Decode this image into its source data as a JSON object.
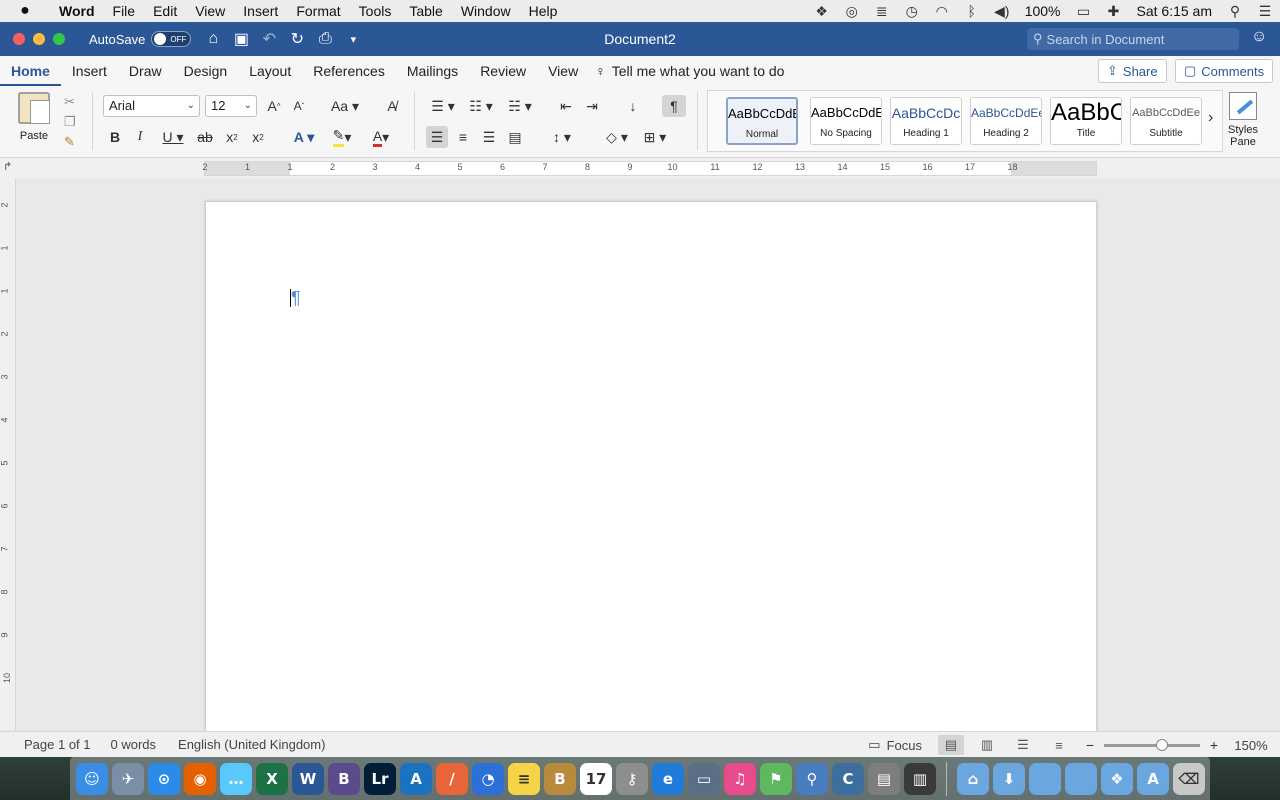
{
  "menubar": {
    "app_name": "Word",
    "items": [
      "File",
      "Edit",
      "View",
      "Insert",
      "Format",
      "Tools",
      "Table",
      "Window",
      "Help"
    ],
    "battery": "100%",
    "clock": "Sat 6:15 am"
  },
  "titlebar": {
    "autosave_label": "AutoSave",
    "autosave_state": "OFF",
    "document_title": "Document2",
    "search_placeholder": "Search in Document"
  },
  "ribbon_tabs": [
    "Home",
    "Insert",
    "Draw",
    "Design",
    "Layout",
    "References",
    "Mailings",
    "Review",
    "View"
  ],
  "active_tab": "Home",
  "tell_me": "Tell me what you want to do",
  "share_label": "Share",
  "comments_label": "Comments",
  "clipboard": {
    "paste_label": "Paste"
  },
  "font": {
    "name": "Arial",
    "size": "12"
  },
  "styles": [
    {
      "sample": "AaBbCcDdEe",
      "name": "Normal",
      "color": "#000000",
      "size": 13
    },
    {
      "sample": "AaBbCcDdEe",
      "name": "No Spacing",
      "color": "#000000",
      "size": 13
    },
    {
      "sample": "AaBbCcDc",
      "name": "Heading 1",
      "color": "#2f5496",
      "size": 14
    },
    {
      "sample": "AaBbCcDdEe",
      "name": "Heading 2",
      "color": "#2f5496",
      "size": 12
    },
    {
      "sample": "AaBbC",
      "name": "Title",
      "color": "#000000",
      "size": 24
    },
    {
      "sample": "AaBbCcDdEe",
      "name": "Subtitle",
      "color": "#595959",
      "size": 11
    }
  ],
  "styles_pane_label": "Styles Pane",
  "ruler": {
    "numbers": [
      "2",
      "1",
      "1",
      "2",
      "3",
      "4",
      "5",
      "6",
      "7",
      "8",
      "9",
      "10",
      "11",
      "12",
      "13",
      "14",
      "15",
      "16",
      "17",
      "18"
    ]
  },
  "vruler": {
    "numbers": [
      "2",
      "1",
      "1",
      "2",
      "3",
      "4",
      "5",
      "6",
      "7",
      "8",
      "9",
      "10"
    ]
  },
  "status": {
    "page": "Page 1 of 1",
    "words": "0 words",
    "language": "English (United Kingdom)",
    "focus_label": "Focus",
    "zoom": "150%"
  },
  "dock": [
    {
      "name": "finder",
      "glyph": "☺",
      "color": "#3a8ee6"
    },
    {
      "name": "preview",
      "glyph": "✈",
      "color": "#7a8fa6"
    },
    {
      "name": "safari",
      "glyph": "⊙",
      "color": "#2c8be8"
    },
    {
      "name": "firefox",
      "glyph": "◉",
      "color": "#e66000"
    },
    {
      "name": "messages",
      "glyph": "…",
      "color": "#5ac8fa"
    },
    {
      "name": "excel",
      "glyph": "X",
      "color": "#1e7145"
    },
    {
      "name": "word",
      "glyph": "W",
      "color": "#2b5797"
    },
    {
      "name": "bbedit",
      "glyph": "B",
      "color": "#5a4b8b"
    },
    {
      "name": "lightroom",
      "glyph": "Lr",
      "color": "#001e36"
    },
    {
      "name": "affinity-designer",
      "glyph": "A",
      "color": "#1b72be"
    },
    {
      "name": "affinity-publisher",
      "glyph": "/",
      "color": "#e8653a"
    },
    {
      "name": "clock",
      "glyph": "◔",
      "color": "#2c6fd6"
    },
    {
      "name": "notes",
      "glyph": "≡",
      "color": "#f5d547"
    },
    {
      "name": "notefile",
      "glyph": "B",
      "color": "#b88a3e"
    },
    {
      "name": "calendar",
      "glyph": "17",
      "color": "#ffffff"
    },
    {
      "name": "keychain",
      "glyph": "⚷",
      "color": "#8e8e8e"
    },
    {
      "name": "edge",
      "glyph": "e",
      "color": "#1f7ad8"
    },
    {
      "name": "image-capture",
      "glyph": "▭",
      "color": "#5a6f86"
    },
    {
      "name": "itunes",
      "glyph": "♫",
      "color": "#e84a8c"
    },
    {
      "name": "maps",
      "glyph": "⚑",
      "color": "#5fb760"
    },
    {
      "name": "spotlight",
      "glyph": "⚲",
      "color": "#4a7dbf"
    },
    {
      "name": "migration",
      "glyph": "C",
      "color": "#3d6e9e"
    },
    {
      "name": "printer",
      "glyph": "▤",
      "color": "#7d7d7d"
    },
    {
      "name": "stats",
      "glyph": "▥",
      "color": "#3a3a3a"
    },
    {
      "name": "home-folder",
      "glyph": "⌂",
      "color": "#6aa6e0"
    },
    {
      "name": "downloads-folder",
      "glyph": "⬇",
      "color": "#6aa6e0"
    },
    {
      "name": "folder-1",
      "glyph": "",
      "color": "#6aa6e0"
    },
    {
      "name": "folder-2",
      "glyph": "",
      "color": "#6aa6e0"
    },
    {
      "name": "dropbox-folder",
      "glyph": "❖",
      "color": "#6aa6e0"
    },
    {
      "name": "applications-folder",
      "glyph": "A",
      "color": "#6aa6e0"
    },
    {
      "name": "trash",
      "glyph": "⌫",
      "color": "#c8c8c8"
    }
  ]
}
